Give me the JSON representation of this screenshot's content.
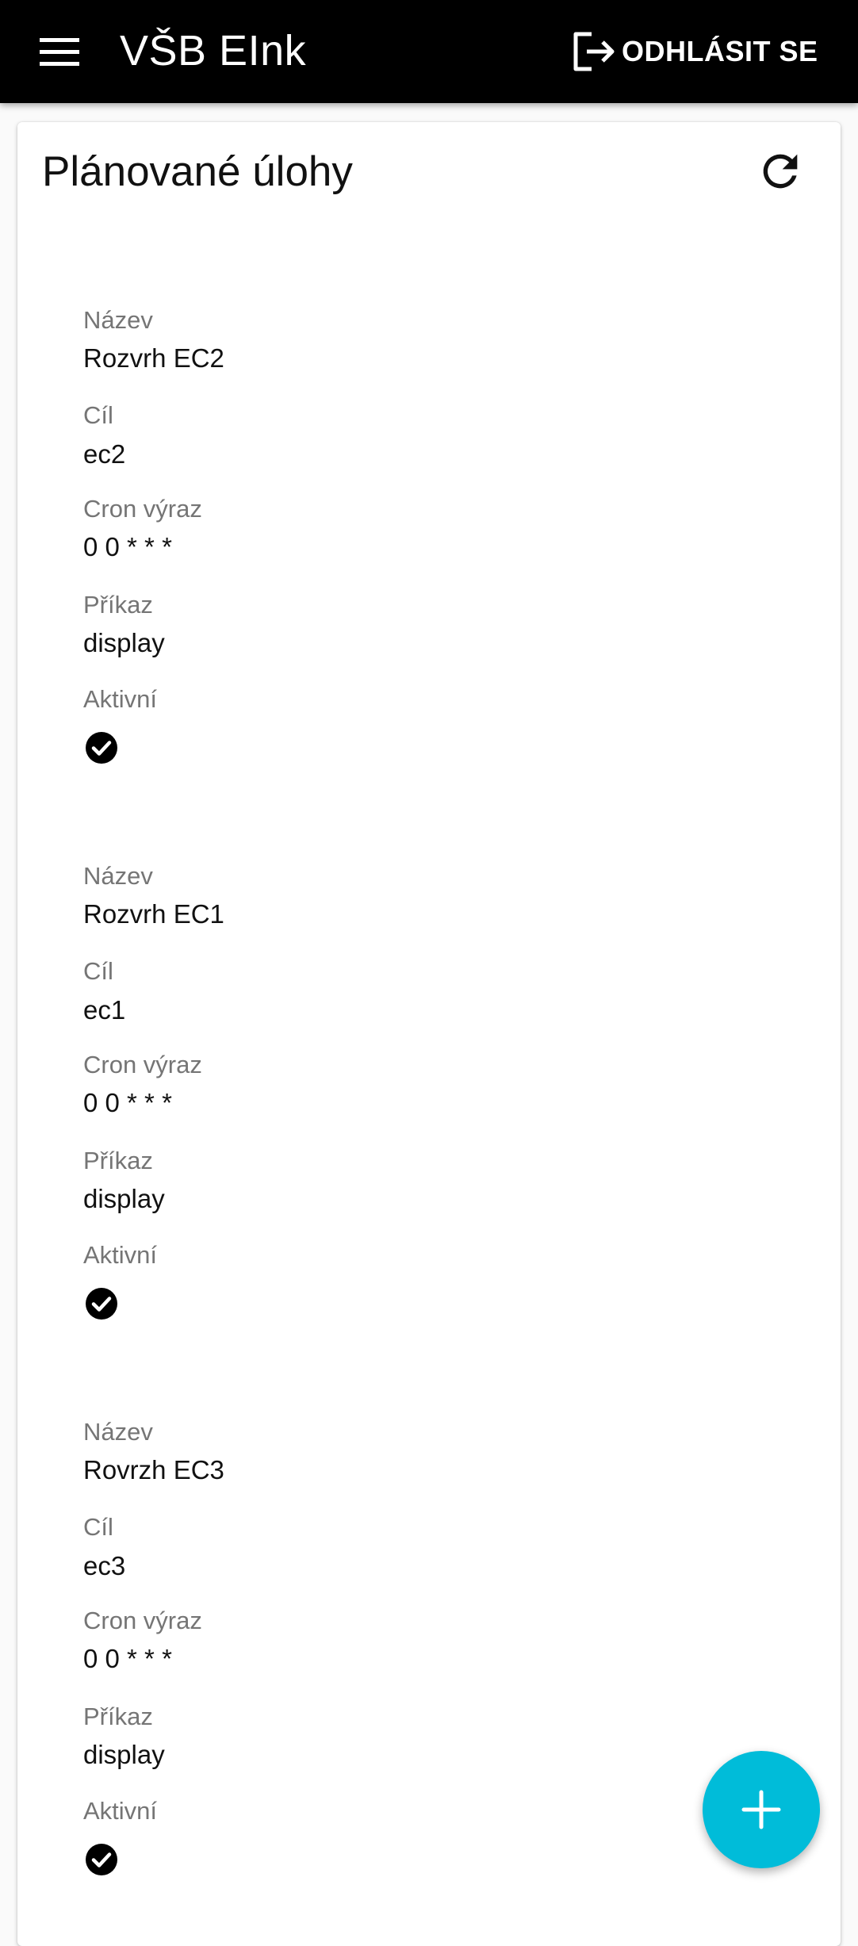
{
  "app": {
    "title": "VŠB EInk",
    "logout_label": "ODHLÁSIT SE"
  },
  "page": {
    "title": "Plánované úlohy"
  },
  "labels": {
    "name": "Název",
    "target": "Cíl",
    "cron": "Cron výraz",
    "command": "Příkaz",
    "active": "Aktivní"
  },
  "jobs": [
    {
      "name": "Rozvrh EC2",
      "target": "ec2",
      "cron": "0 0 * * *",
      "command": "display",
      "active": true
    },
    {
      "name": "Rozvrh EC1",
      "target": "ec1",
      "cron": "0 0 * * *",
      "command": "display",
      "active": true
    },
    {
      "name": "Rovrzh EC3",
      "target": "ec3",
      "cron": "0 0 * * *",
      "command": "display",
      "active": true
    }
  ],
  "icons": {
    "menu": "menu-icon",
    "logout": "logout-icon",
    "refresh": "refresh-icon",
    "active": "check-circle-icon",
    "add": "add-icon"
  },
  "colors": {
    "appbar": "#000000",
    "fab": "#00bcd9",
    "label": "#757575"
  }
}
